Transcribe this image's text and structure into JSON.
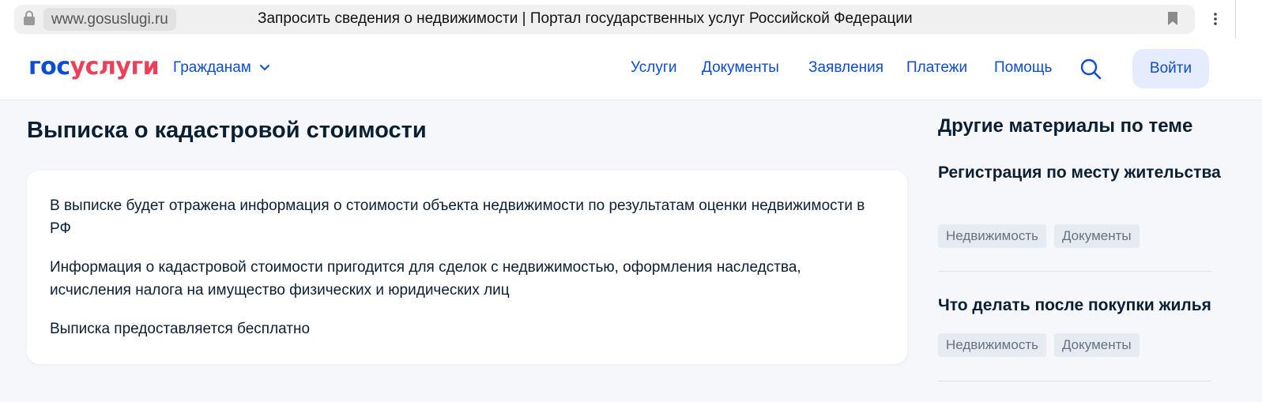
{
  "browser": {
    "url": "www.gosuslugi.ru",
    "tab_title": "Запросить сведения о недвижимости | Портал государственных услуг Российской Федерации"
  },
  "header": {
    "logo_part1": "гос",
    "logo_part2": "услуги",
    "citizens_label": "Гражданам",
    "nav": [
      "Услуги",
      "Документы",
      "Заявления",
      "Платежи",
      "Помощь"
    ],
    "login_label": "Войти"
  },
  "main": {
    "title": "Выписка о кадастровой стоимости",
    "paragraphs": [
      "В выписке будет отражена информация о стоимости объекта недвижимости по результатам оценки недвижимости в РФ",
      "Информация о кадастровой стоимости пригодится для сделок с недвижимостью, оформления наследства, исчисления налога на имущество физических и юридических лиц",
      "Выписка предоставляется бесплатно"
    ]
  },
  "sidebar": {
    "title": "Другие материалы по теме",
    "articles": [
      {
        "title": "Регистрация по месту жительства",
        "tags": [
          "Недвижимость",
          "Документы"
        ]
      },
      {
        "title": "Что делать после покупки жилья",
        "tags": [
          "Недвижимость",
          "Документы"
        ]
      }
    ]
  },
  "colors": {
    "primary_blue": "#0d4cd3",
    "brand_red": "#ee3f58",
    "page_bg": "#f5f7fa",
    "button_bg": "#e4ecfd"
  }
}
